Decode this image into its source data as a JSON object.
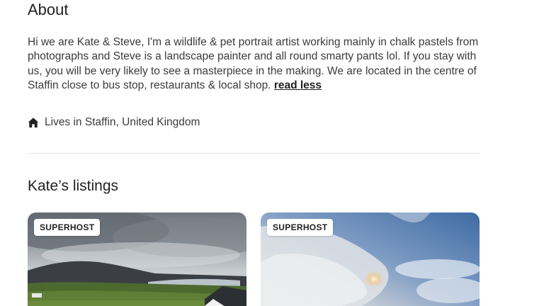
{
  "about": {
    "heading": "About",
    "bio": "Hi we are Kate & Steve, I'm a wildlife & pet portrait artist working mainly in chalk pastels from photographs and Steve is a landscape painter and all round smarty pants lol. If you stay with us, you will be very likely to see a masterpiece in the making. We are located in the centre of Staffin close to bus stop, restaurants & local shop.",
    "read_less_label": "read less",
    "lives_in": "Lives in Staffin, United Kingdom",
    "lives_in_icon": "home-icon"
  },
  "listings": {
    "heading": "Kate’s listings",
    "cards": [
      {
        "badge": "SUPERHOST",
        "photo": "landscape-green-fields-cloudy-sky"
      },
      {
        "badge": "SUPERHOST",
        "photo": "sky-clouds-sun-halo"
      }
    ]
  },
  "colors": {
    "text_primary": "#222222",
    "text_body": "#3b3b3b",
    "divider": "#e4e4e4",
    "background": "#ffffff"
  }
}
